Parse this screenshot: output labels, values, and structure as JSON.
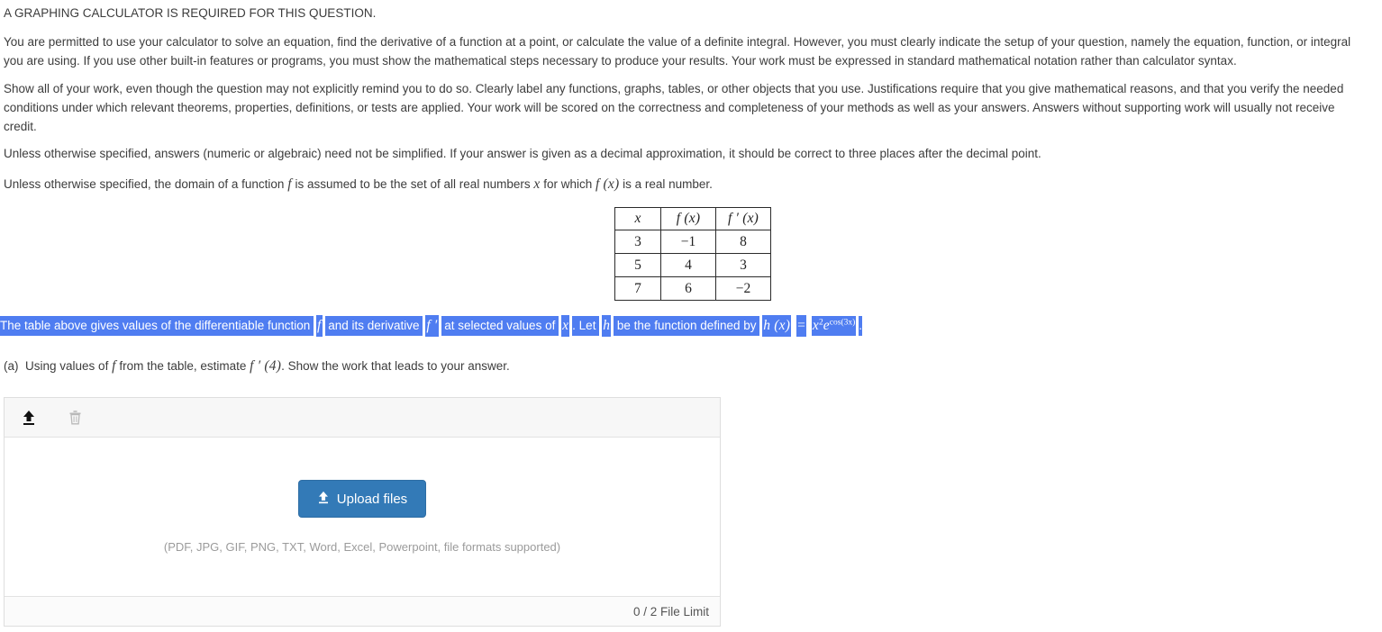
{
  "instructions": {
    "calculator_notice": "A GRAPHING CALCULATOR IS REQUIRED FOR THIS QUESTION.",
    "paragraph_1": "You are permitted to use your calculator to solve an equation, find the derivative of a function at a point, or calculate the value of a definite integral. However, you must clearly indicate the setup of your question, namely the equation, function, or integral you are using. If you use other built-in features or programs, you must show the mathematical steps necessary to produce your results. Your work must be expressed in standard mathematical notation rather than calculator syntax.",
    "paragraph_2": "Show all of your work, even though the question may not explicitly remind you to do so. Clearly label any functions, graphs, tables, or other objects that you use. Justifications require that you give mathematical reasons, and that you verify the needed conditions under which relevant theorems, properties, definitions, or tests are applied. Your work will be scored on the correctness and completeness of your methods as well as your answers. Answers without supporting work will usually not receive credit.",
    "paragraph_3": "Unless otherwise specified, answers (numeric or algebraic) need not be simplified. If your answer is given as a decimal approximation, it should be correct to three places after the decimal point.",
    "paragraph_4_pre": "Unless otherwise specified, the domain of a function ",
    "paragraph_4_f": "f",
    "paragraph_4_mid": " is assumed to be the set of all real numbers ",
    "paragraph_4_x": "x",
    "paragraph_4_mid2": " for which ",
    "paragraph_4_fx": "f (x)",
    "paragraph_4_end": " is a real number."
  },
  "table": {
    "headers": [
      "x",
      "f (x)",
      "f ′ (x)"
    ],
    "rows": [
      [
        "3",
        "−1",
        "8"
      ],
      [
        "5",
        "4",
        "3"
      ],
      [
        "7",
        "6",
        "−2"
      ]
    ]
  },
  "selected_sentence": {
    "seg1": "The table above gives values of the differentiable function ",
    "math_f": "f",
    "seg2": " and its derivative ",
    "math_fprime": "f ′",
    "seg3": " at selected values of ",
    "math_x": "x",
    "seg4": ". Let ",
    "math_h": "h",
    "seg5": " be the function defined by ",
    "math_hx": "h (x)",
    "math_eq": "=",
    "math_expr_base": "x",
    "math_expr_exp": "2",
    "math_expr_e": "e",
    "math_expr_eexp": "cos(3x)",
    "trailing": ".",
    "highlight_color": "#4f7df1",
    "highlight_text_color": "#ffffff"
  },
  "part_a": {
    "label": "(a)",
    "text_pre": "Using values of ",
    "f": "f",
    "text_mid": " from the table, estimate ",
    "fprime4": "f ′ (4)",
    "text_end": ". Show the work that leads to your answer."
  },
  "upload": {
    "toolbar": {
      "upload_icon": "upload-icon",
      "delete_icon": "trash-icon"
    },
    "button_label": "Upload files",
    "button_icon": "upload-icon",
    "button_color": "#337ab7",
    "formats_note": "(PDF, JPG, GIF, PNG, TXT, Word, Excel, Powerpoint, file formats supported)",
    "file_limit": "0 / 2 File Limit"
  }
}
